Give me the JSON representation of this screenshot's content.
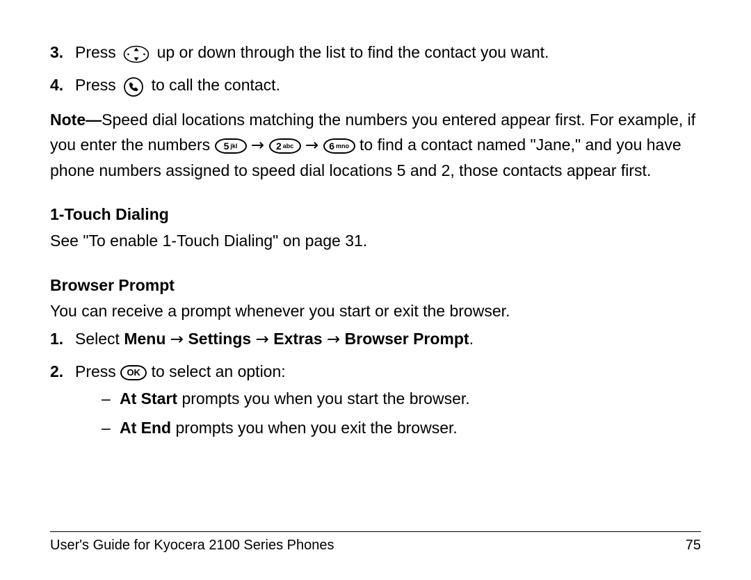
{
  "steps_top": {
    "s3": {
      "num": "3.",
      "before": "Press ",
      "after": " up or down through the list to find the contact you want."
    },
    "s4": {
      "num": "4.",
      "before": "Press ",
      "after": " to call the contact."
    }
  },
  "note": {
    "label": "Note—",
    "text1": "Speed dial locations matching the numbers you entered appear first. For example, if you enter the numbers ",
    "text2": " to find a contact named \"Jane,\" and you have phone numbers assigned to speed dial locations 5 and 2, those contacts appear first."
  },
  "keys": {
    "k5_big": "5",
    "k5_small": "jkl",
    "k2_big": "2",
    "k2_small": "abc",
    "k6_big": "6",
    "k6_small": "mno",
    "ok": "OK"
  },
  "arrow": "→",
  "touch": {
    "heading": "1-Touch Dialing",
    "body": "See \"To enable 1-Touch Dialing\" on page 31."
  },
  "browser": {
    "heading": "Browser Prompt",
    "intro": "You can receive a prompt whenever you start or exit the browser.",
    "s1": {
      "num": "1.",
      "lead": "Select ",
      "path": [
        "Menu",
        "Settings",
        "Extras",
        "Browser Prompt"
      ],
      "period": "."
    },
    "s2": {
      "num": "2.",
      "before": "Press ",
      "after": " to select an option:"
    },
    "opts": {
      "a_bold": "At Start",
      "a_rest": " prompts you when you start the browser.",
      "b_bold": "At End",
      "b_rest": " prompts you when you exit the browser."
    }
  },
  "footer": {
    "title": "User's Guide for Kyocera 2100 Series Phones",
    "page": "75"
  }
}
